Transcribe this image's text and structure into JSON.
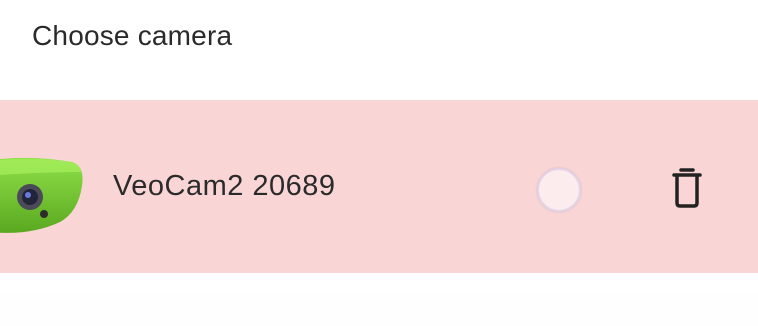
{
  "header": {
    "title": "Choose camera"
  },
  "cameras": [
    {
      "name": "VeoCam2 20689",
      "selected": false,
      "thumbnail_icon": "green-camera-device",
      "delete_icon": "trash-icon"
    }
  ],
  "colors": {
    "row_background": "#f9d6d5",
    "device_green": "#7ccf3a",
    "text": "#2b2b2b"
  }
}
